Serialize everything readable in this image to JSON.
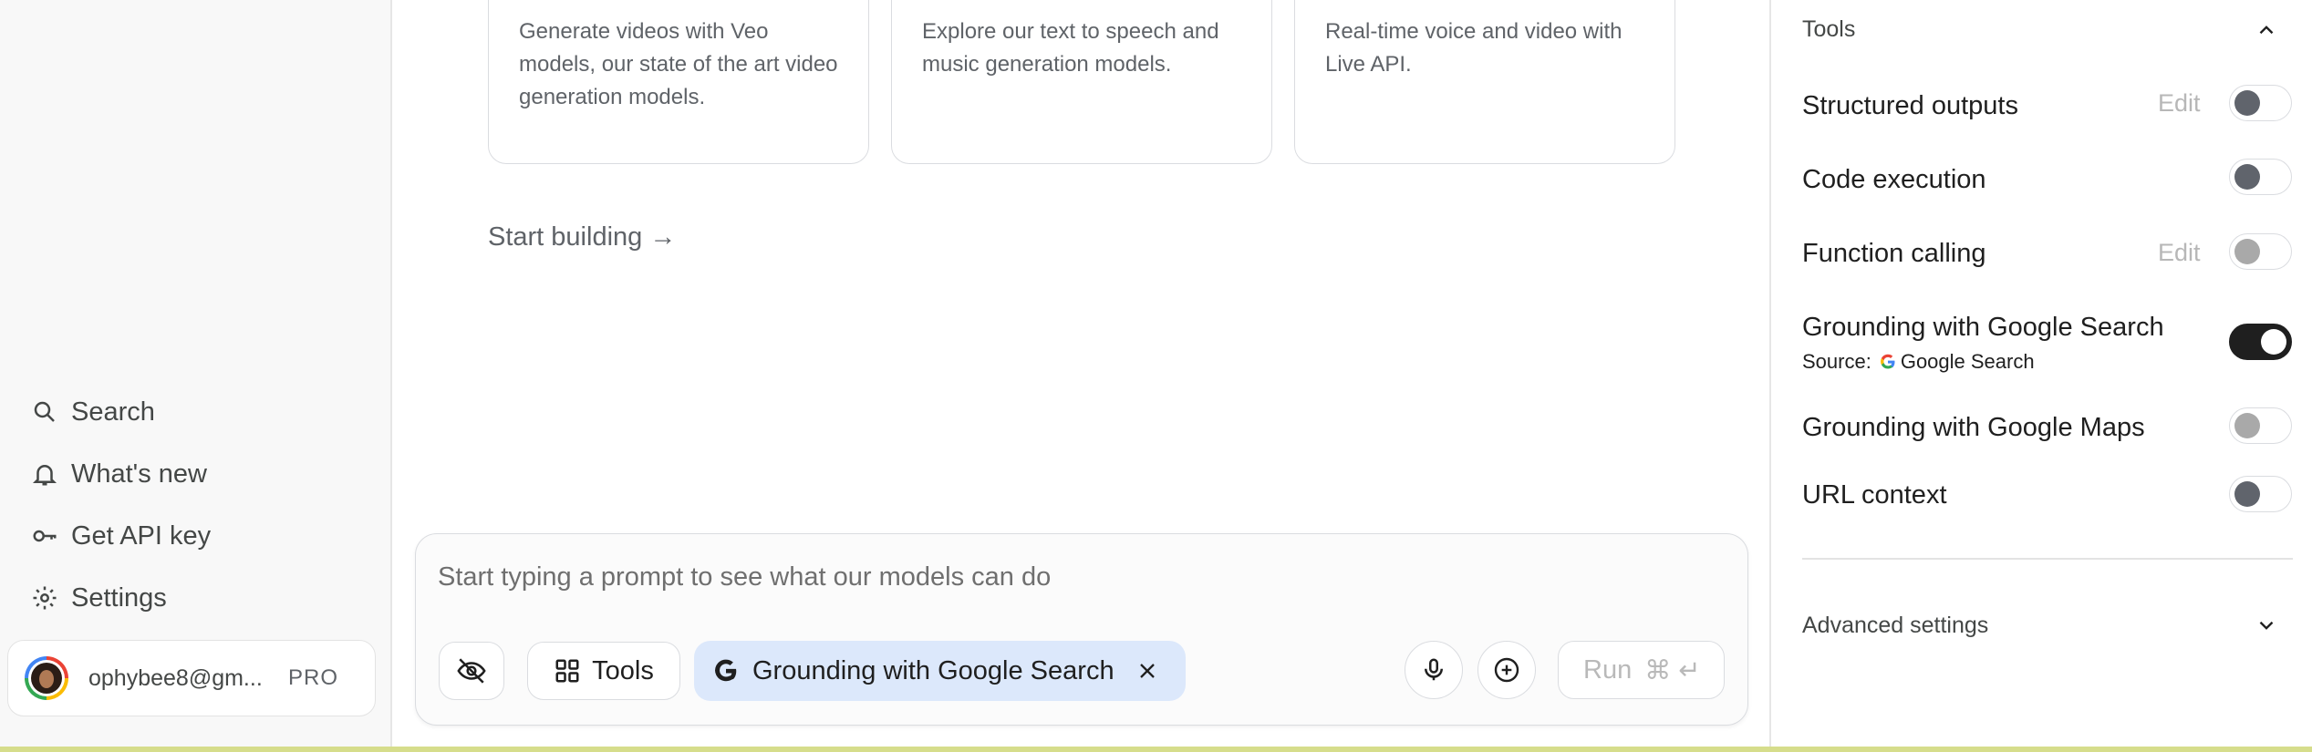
{
  "sidebar": {
    "items": [
      {
        "label": "Search",
        "icon": "search-icon"
      },
      {
        "label": "What's new",
        "icon": "bell-icon"
      },
      {
        "label": "Get API key",
        "icon": "key-icon"
      },
      {
        "label": "Settings",
        "icon": "gear-icon"
      }
    ],
    "account": {
      "email": "ophybee8@gm...",
      "plan": "PRO"
    }
  },
  "main": {
    "cards": [
      {
        "text": "Generate videos with Veo models, our state of the art video generation models."
      },
      {
        "text": "Explore our text to speech and music generation models."
      },
      {
        "text": "Real-time voice and video with Live API."
      }
    ],
    "start_building": "Start building →"
  },
  "prompt": {
    "placeholder": "Start typing a prompt to see what our models can do",
    "tools_label": "Tools",
    "chip_label": "Grounding with Google Search",
    "run_label": "Run",
    "run_shortcut": "⌘ ↵"
  },
  "right_panel": {
    "tools_heading": "Tools",
    "rows": [
      {
        "label": "Structured outputs",
        "edit": "Edit",
        "toggle": "off"
      },
      {
        "label": "Code execution",
        "toggle": "off"
      },
      {
        "label": "Function calling",
        "edit": "Edit",
        "toggle": "disabled"
      },
      {
        "label": "Grounding with Google Search",
        "toggle": "on"
      },
      {
        "label": "Grounding with Google Maps",
        "toggle": "disabled"
      },
      {
        "label": "URL context",
        "toggle": "off"
      }
    ],
    "source_label": "Source:",
    "source_value": "Google Search",
    "advanced_settings": "Advanced settings"
  },
  "colors": {
    "chip_bg": "#dce8fb",
    "toggle_on": "#1f1f1f",
    "bottom_bar": "#d6dd8b"
  }
}
